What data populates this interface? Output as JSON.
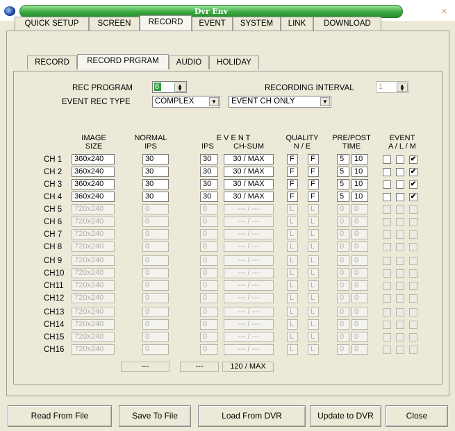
{
  "window": {
    "title": "Dvr Env",
    "close_glyph": "×"
  },
  "main_tabs": [
    "QUICK SETUP",
    "SCREEN",
    "RECORD",
    "EVENT",
    "SYSTEM",
    "LINK",
    "DOWNLOAD"
  ],
  "sub_tabs": [
    "RECORD",
    "RECORD PRGRAM",
    "AUDIO",
    "HOLIDAY"
  ],
  "settings": {
    "rec_program_label": "REC PROGRAM",
    "rec_program_value": "6",
    "recording_interval_label": "RECORDING INTERVAL",
    "recording_interval_value": "1",
    "event_rec_type_label": "EVENT REC TYPE",
    "event_rec_type_value": "COMPLEX",
    "event_ch_value": "EVENT CH ONLY"
  },
  "headers": {
    "image": "IMAGE",
    "size": "SIZE",
    "normal": "NORMAL",
    "ips": "IPS",
    "event": "E V E N T",
    "ev_ips": "IPS",
    "ch_sum": "CH-SUM",
    "quality": "QUALITY",
    "n_e": "N / E",
    "prepost": "PRE/POST",
    "time": "TIME",
    "event2": "EVENT",
    "alm": "A / L / M"
  },
  "rows": [
    {
      "ch": "CH 1",
      "size": "360x240",
      "normal_ips": "30",
      "event_ips": "30",
      "ch_sum": "30 / MAX",
      "q_n": "F",
      "q_e": "F",
      "pre": "5",
      "post": "10",
      "a": "",
      "l": "",
      "m": "✔",
      "enabled": true
    },
    {
      "ch": "CH 2",
      "size": "360x240",
      "normal_ips": "30",
      "event_ips": "30",
      "ch_sum": "30 / MAX",
      "q_n": "F",
      "q_e": "F",
      "pre": "5",
      "post": "10",
      "a": "",
      "l": "",
      "m": "✔",
      "enabled": true
    },
    {
      "ch": "CH 3",
      "size": "360x240",
      "normal_ips": "30",
      "event_ips": "30",
      "ch_sum": "30 / MAX",
      "q_n": "F",
      "q_e": "F",
      "pre": "5",
      "post": "10",
      "a": "",
      "l": "",
      "m": "✔",
      "enabled": true
    },
    {
      "ch": "CH 4",
      "size": "360x240",
      "normal_ips": "30",
      "event_ips": "30",
      "ch_sum": "30 / MAX",
      "q_n": "F",
      "q_e": "F",
      "pre": "5",
      "post": "10",
      "a": "",
      "l": "",
      "m": "✔",
      "enabled": true
    },
    {
      "ch": "CH 5",
      "size": "720x240",
      "normal_ips": "0",
      "event_ips": "0",
      "ch_sum": "--- / ---",
      "q_n": "L",
      "q_e": "L",
      "pre": "0",
      "post": "0",
      "a": "",
      "l": "",
      "m": "",
      "enabled": false
    },
    {
      "ch": "CH 6",
      "size": "720x240",
      "normal_ips": "0",
      "event_ips": "0",
      "ch_sum": "--- / ---",
      "q_n": "L",
      "q_e": "L",
      "pre": "0",
      "post": "0",
      "a": "",
      "l": "",
      "m": "",
      "enabled": false
    },
    {
      "ch": "CH 7",
      "size": "720x240",
      "normal_ips": "0",
      "event_ips": "0",
      "ch_sum": "--- / ---",
      "q_n": "L",
      "q_e": "L",
      "pre": "0",
      "post": "0",
      "a": "",
      "l": "",
      "m": "",
      "enabled": false
    },
    {
      "ch": "CH 8",
      "size": "720x240",
      "normal_ips": "0",
      "event_ips": "0",
      "ch_sum": "--- / ---",
      "q_n": "L",
      "q_e": "L",
      "pre": "0",
      "post": "0",
      "a": "",
      "l": "",
      "m": "",
      "enabled": false
    },
    {
      "ch": "CH 9",
      "size": "720x240",
      "normal_ips": "0",
      "event_ips": "0",
      "ch_sum": "--- / ---",
      "q_n": "L",
      "q_e": "L",
      "pre": "0",
      "post": "0",
      "a": "",
      "l": "",
      "m": "",
      "enabled": false
    },
    {
      "ch": "CH10",
      "size": "720x240",
      "normal_ips": "0",
      "event_ips": "0",
      "ch_sum": "--- / ---",
      "q_n": "L",
      "q_e": "L",
      "pre": "0",
      "post": "0",
      "a": "",
      "l": "",
      "m": "",
      "enabled": false
    },
    {
      "ch": "CH11",
      "size": "720x240",
      "normal_ips": "0",
      "event_ips": "0",
      "ch_sum": "--- / ---",
      "q_n": "L",
      "q_e": "L",
      "pre": "0",
      "post": "0",
      "a": "",
      "l": "",
      "m": "",
      "enabled": false
    },
    {
      "ch": "CH12",
      "size": "720x240",
      "normal_ips": "0",
      "event_ips": "0",
      "ch_sum": "--- / ---",
      "q_n": "L",
      "q_e": "L",
      "pre": "0",
      "post": "0",
      "a": "",
      "l": "",
      "m": "",
      "enabled": false
    },
    {
      "ch": "CH13",
      "size": "720x240",
      "normal_ips": "0",
      "event_ips": "0",
      "ch_sum": "--- / ---",
      "q_n": "L",
      "q_e": "L",
      "pre": "0",
      "post": "0",
      "a": "",
      "l": "",
      "m": "",
      "enabled": false
    },
    {
      "ch": "CH14",
      "size": "720x240",
      "normal_ips": "0",
      "event_ips": "0",
      "ch_sum": "--- / ---",
      "q_n": "L",
      "q_e": "L",
      "pre": "0",
      "post": "0",
      "a": "",
      "l": "",
      "m": "",
      "enabled": false
    },
    {
      "ch": "CH15",
      "size": "720x240",
      "normal_ips": "0",
      "event_ips": "0",
      "ch_sum": "--- / ---",
      "q_n": "L",
      "q_e": "L",
      "pre": "0",
      "post": "0",
      "a": "",
      "l": "",
      "m": "",
      "enabled": false
    },
    {
      "ch": "CH16",
      "size": "720x240",
      "normal_ips": "0",
      "event_ips": "0",
      "ch_sum": "--- / ---",
      "q_n": "L",
      "q_e": "L",
      "pre": "0",
      "post": "0",
      "a": "",
      "l": "",
      "m": "",
      "enabled": false
    }
  ],
  "totals": {
    "normal_ips": "---",
    "event_ips": "---",
    "ch_sum": "120 / MAX"
  },
  "buttons": [
    "Read From File",
    "Save To File",
    "Load From DVR",
    "Update to DVR",
    "Close"
  ],
  "colors": {
    "face": "#ece9d8",
    "title_green": "#39a83d",
    "disabled_text": "#b0aea2"
  },
  "icons": {
    "app": "dvr-app-icon",
    "close": "close-icon",
    "spin": "spin-up-down-icon",
    "dropdown": "dropdown-arrow-icon",
    "check": "checkmark-icon"
  }
}
